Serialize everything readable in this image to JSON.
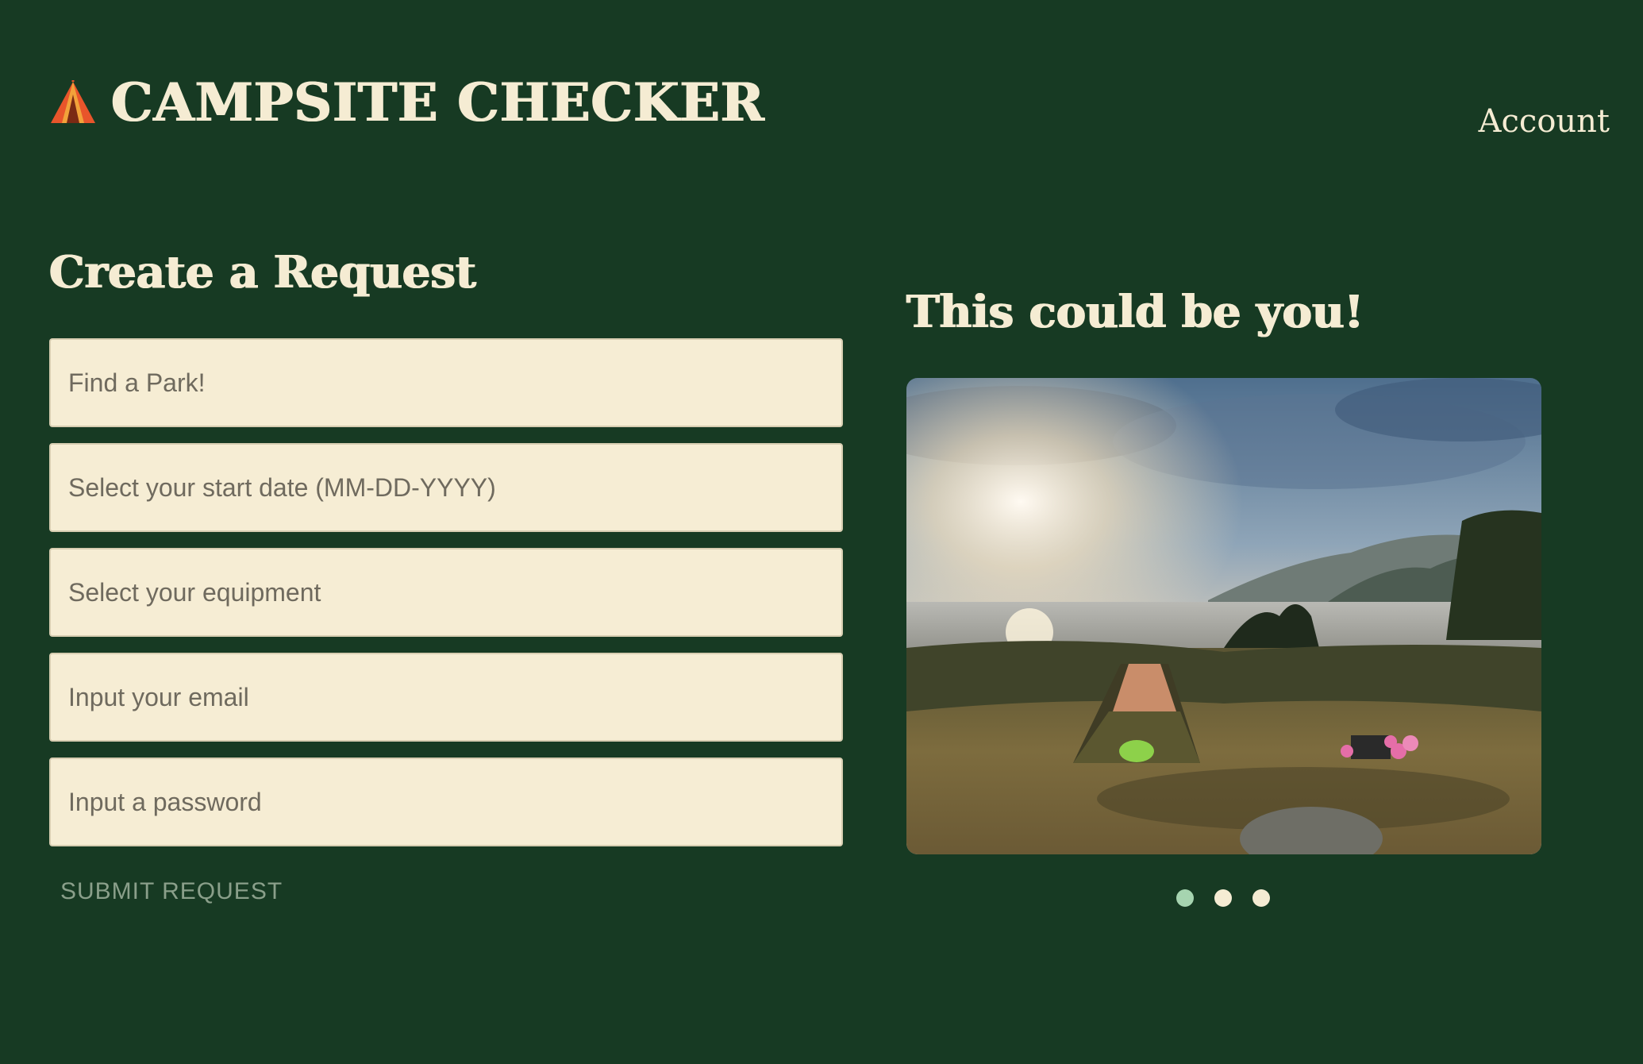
{
  "header": {
    "brand_title": "CAMPSITE CHECKER",
    "brand_icon": "tent-icon",
    "account_label": "Account"
  },
  "form": {
    "title": "Create a Request",
    "fields": [
      {
        "name": "park",
        "placeholder": "Find a Park!",
        "value": ""
      },
      {
        "name": "start_date",
        "placeholder": "Select your start date (MM-DD-YYYY)",
        "value": ""
      },
      {
        "name": "equipment",
        "placeholder": "Select your equipment",
        "value": ""
      },
      {
        "name": "email",
        "placeholder": "Input your email",
        "value": ""
      },
      {
        "name": "password",
        "placeholder": "Input a password",
        "value": ""
      }
    ],
    "submit_label": "SUBMIT REQUEST"
  },
  "showcase": {
    "title": "This could be you!",
    "image_subject": "tent at a coastal campsite at sunset",
    "slide_count": 3,
    "active_slide": 1
  },
  "colors": {
    "background": "#173a23",
    "cream": "#f5ecd3",
    "field_background": "#f6edd4",
    "active_dot": "#a6d4b0",
    "submit_text": "#8a9f8a"
  }
}
